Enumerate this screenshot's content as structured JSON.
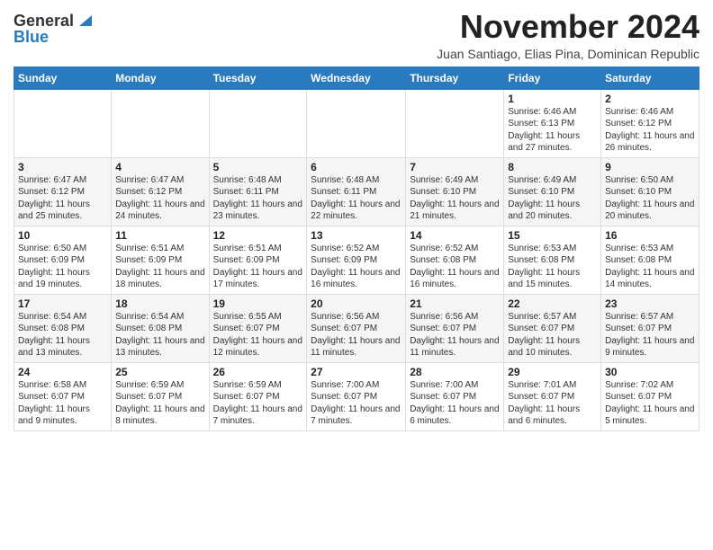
{
  "logo": {
    "general": "General",
    "blue": "Blue",
    "icon_label": "blue-triangle-icon"
  },
  "header": {
    "month_title": "November 2024",
    "subtitle": "Juan Santiago, Elias Pina, Dominican Republic"
  },
  "weekdays": [
    "Sunday",
    "Monday",
    "Tuesday",
    "Wednesday",
    "Thursday",
    "Friday",
    "Saturday"
  ],
  "weeks": [
    [
      {
        "day": "",
        "info": ""
      },
      {
        "day": "",
        "info": ""
      },
      {
        "day": "",
        "info": ""
      },
      {
        "day": "",
        "info": ""
      },
      {
        "day": "",
        "info": ""
      },
      {
        "day": "1",
        "info": "Sunrise: 6:46 AM\nSunset: 6:13 PM\nDaylight: 11 hours and 27 minutes."
      },
      {
        "day": "2",
        "info": "Sunrise: 6:46 AM\nSunset: 6:12 PM\nDaylight: 11 hours and 26 minutes."
      }
    ],
    [
      {
        "day": "3",
        "info": "Sunrise: 6:47 AM\nSunset: 6:12 PM\nDaylight: 11 hours and 25 minutes."
      },
      {
        "day": "4",
        "info": "Sunrise: 6:47 AM\nSunset: 6:12 PM\nDaylight: 11 hours and 24 minutes."
      },
      {
        "day": "5",
        "info": "Sunrise: 6:48 AM\nSunset: 6:11 PM\nDaylight: 11 hours and 23 minutes."
      },
      {
        "day": "6",
        "info": "Sunrise: 6:48 AM\nSunset: 6:11 PM\nDaylight: 11 hours and 22 minutes."
      },
      {
        "day": "7",
        "info": "Sunrise: 6:49 AM\nSunset: 6:10 PM\nDaylight: 11 hours and 21 minutes."
      },
      {
        "day": "8",
        "info": "Sunrise: 6:49 AM\nSunset: 6:10 PM\nDaylight: 11 hours and 20 minutes."
      },
      {
        "day": "9",
        "info": "Sunrise: 6:50 AM\nSunset: 6:10 PM\nDaylight: 11 hours and 20 minutes."
      }
    ],
    [
      {
        "day": "10",
        "info": "Sunrise: 6:50 AM\nSunset: 6:09 PM\nDaylight: 11 hours and 19 minutes."
      },
      {
        "day": "11",
        "info": "Sunrise: 6:51 AM\nSunset: 6:09 PM\nDaylight: 11 hours and 18 minutes."
      },
      {
        "day": "12",
        "info": "Sunrise: 6:51 AM\nSunset: 6:09 PM\nDaylight: 11 hours and 17 minutes."
      },
      {
        "day": "13",
        "info": "Sunrise: 6:52 AM\nSunset: 6:09 PM\nDaylight: 11 hours and 16 minutes."
      },
      {
        "day": "14",
        "info": "Sunrise: 6:52 AM\nSunset: 6:08 PM\nDaylight: 11 hours and 16 minutes."
      },
      {
        "day": "15",
        "info": "Sunrise: 6:53 AM\nSunset: 6:08 PM\nDaylight: 11 hours and 15 minutes."
      },
      {
        "day": "16",
        "info": "Sunrise: 6:53 AM\nSunset: 6:08 PM\nDaylight: 11 hours and 14 minutes."
      }
    ],
    [
      {
        "day": "17",
        "info": "Sunrise: 6:54 AM\nSunset: 6:08 PM\nDaylight: 11 hours and 13 minutes."
      },
      {
        "day": "18",
        "info": "Sunrise: 6:54 AM\nSunset: 6:08 PM\nDaylight: 11 hours and 13 minutes."
      },
      {
        "day": "19",
        "info": "Sunrise: 6:55 AM\nSunset: 6:07 PM\nDaylight: 11 hours and 12 minutes."
      },
      {
        "day": "20",
        "info": "Sunrise: 6:56 AM\nSunset: 6:07 PM\nDaylight: 11 hours and 11 minutes."
      },
      {
        "day": "21",
        "info": "Sunrise: 6:56 AM\nSunset: 6:07 PM\nDaylight: 11 hours and 11 minutes."
      },
      {
        "day": "22",
        "info": "Sunrise: 6:57 AM\nSunset: 6:07 PM\nDaylight: 11 hours and 10 minutes."
      },
      {
        "day": "23",
        "info": "Sunrise: 6:57 AM\nSunset: 6:07 PM\nDaylight: 11 hours and 9 minutes."
      }
    ],
    [
      {
        "day": "24",
        "info": "Sunrise: 6:58 AM\nSunset: 6:07 PM\nDaylight: 11 hours and 9 minutes."
      },
      {
        "day": "25",
        "info": "Sunrise: 6:59 AM\nSunset: 6:07 PM\nDaylight: 11 hours and 8 minutes."
      },
      {
        "day": "26",
        "info": "Sunrise: 6:59 AM\nSunset: 6:07 PM\nDaylight: 11 hours and 7 minutes."
      },
      {
        "day": "27",
        "info": "Sunrise: 7:00 AM\nSunset: 6:07 PM\nDaylight: 11 hours and 7 minutes."
      },
      {
        "day": "28",
        "info": "Sunrise: 7:00 AM\nSunset: 6:07 PM\nDaylight: 11 hours and 6 minutes."
      },
      {
        "day": "29",
        "info": "Sunrise: 7:01 AM\nSunset: 6:07 PM\nDaylight: 11 hours and 6 minutes."
      },
      {
        "day": "30",
        "info": "Sunrise: 7:02 AM\nSunset: 6:07 PM\nDaylight: 11 hours and 5 minutes."
      }
    ]
  ]
}
